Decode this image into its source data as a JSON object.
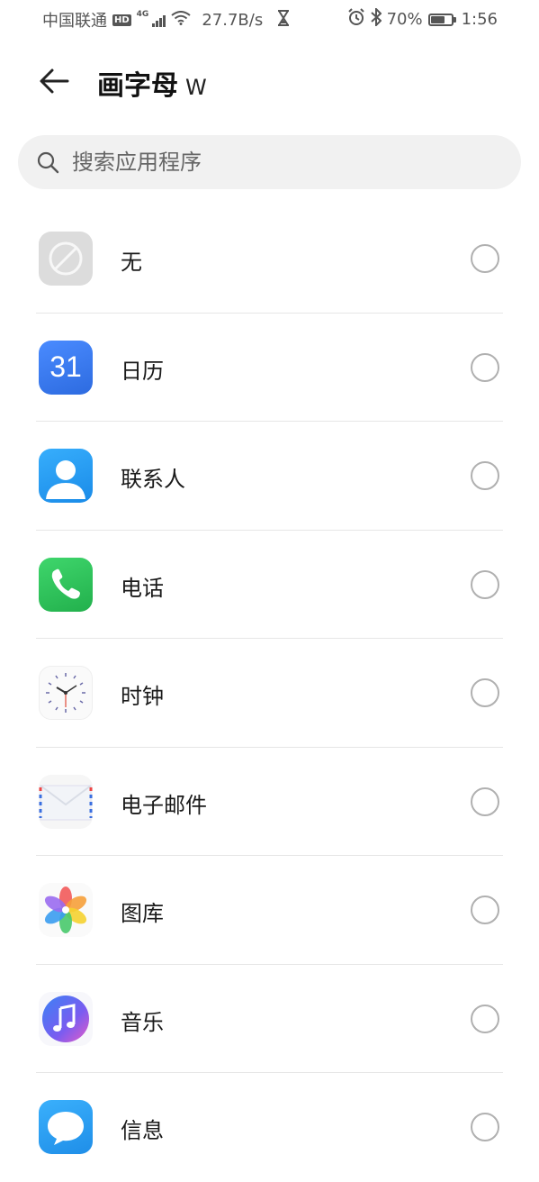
{
  "status_bar": {
    "carrier": "中国联通",
    "hd": "HD",
    "network": "4G",
    "speed": "27.7B/s",
    "battery": "70%",
    "battery_level": 0.7,
    "time": "1:56"
  },
  "header": {
    "back_icon": "arrow-left-icon",
    "title": "画字母",
    "title_suffix": "W"
  },
  "search": {
    "placeholder": "搜索应用程序",
    "value": ""
  },
  "apps": [
    {
      "label": "无",
      "icon": "none-icon",
      "selected": false
    },
    {
      "label": "日历",
      "icon": "calendar-icon",
      "icon_text": "31",
      "selected": false
    },
    {
      "label": "联系人",
      "icon": "contacts-icon",
      "selected": false
    },
    {
      "label": "电话",
      "icon": "phone-icon",
      "selected": false
    },
    {
      "label": "时钟",
      "icon": "clock-icon",
      "selected": false
    },
    {
      "label": "电子邮件",
      "icon": "email-icon",
      "selected": false
    },
    {
      "label": "图库",
      "icon": "gallery-icon",
      "selected": false
    },
    {
      "label": "音乐",
      "icon": "music-icon",
      "selected": false
    },
    {
      "label": "信息",
      "icon": "messages-icon",
      "selected": false
    }
  ],
  "colors": {
    "calendar": "#3a7cf0",
    "contacts": "#1f9df2",
    "phone": "#2fc25b",
    "messages": "#2a9bf2",
    "radio_border": "#b0b0b0"
  }
}
